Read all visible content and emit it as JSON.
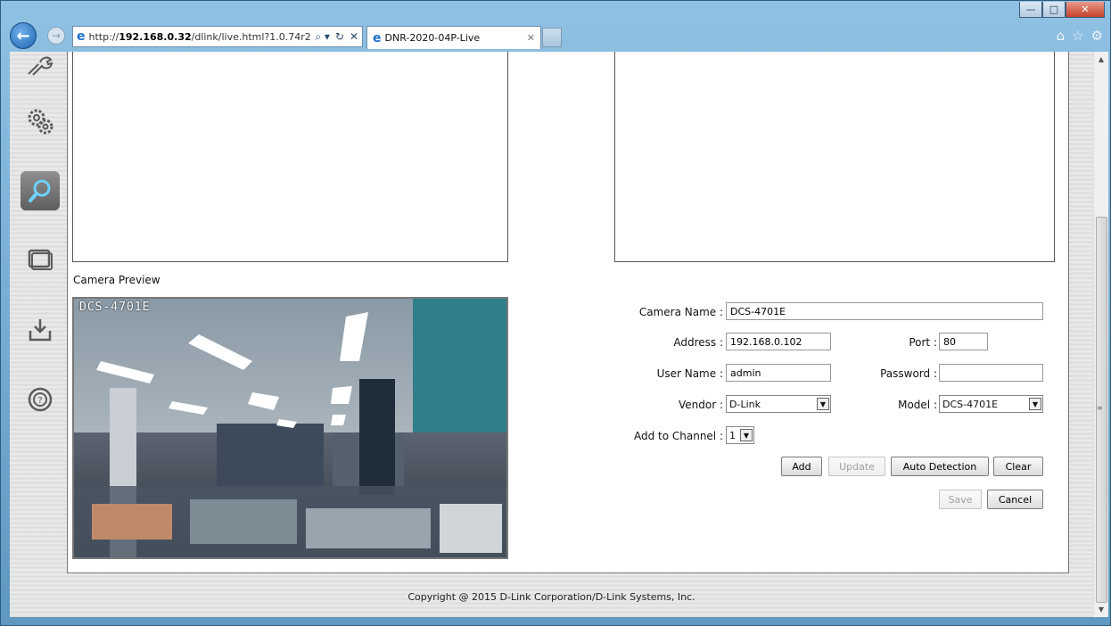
{
  "browser": {
    "window_controls": [
      "—",
      "□",
      "✕"
    ],
    "url_prefix": "http://",
    "url_host": "192.168.0.32",
    "url_path": "/dlink/live.html?1.0.74r2",
    "address_actions": [
      "⌕ ▾",
      "↻",
      "✕"
    ],
    "tab_title": "DNR-2020-04P-Live",
    "tab_close": "✕",
    "tools": [
      "⌂",
      "☆",
      "⚙"
    ]
  },
  "sidebar": {
    "items": [
      {
        "icon": "tools-icon"
      },
      {
        "icon": "settings-gears-icon"
      },
      {
        "icon": "search-icon",
        "active": true
      },
      {
        "icon": "playback-icon"
      },
      {
        "icon": "download-icon"
      },
      {
        "icon": "help-icon"
      }
    ]
  },
  "preview": {
    "label": "Camera Preview",
    "overlay_text": "DCS-4701E"
  },
  "form": {
    "camera_name_label": "Camera Name :",
    "camera_name_value": "DCS-4701E",
    "address_label": "Address :",
    "address_value": "192.168.0.102",
    "port_label": "Port :",
    "port_value": "80",
    "user_name_label": "User Name :",
    "user_name_value": "admin",
    "password_label": "Password :",
    "password_value": "",
    "vendor_label": "Vendor :",
    "vendor_value": "D-Link",
    "model_label": "Model :",
    "model_value": "DCS-4701E",
    "channel_label": "Add to Channel :",
    "channel_value": "1"
  },
  "buttons": {
    "add": "Add",
    "update": "Update",
    "auto_detection": "Auto Detection",
    "clear": "Clear",
    "save": "Save",
    "cancel": "Cancel"
  },
  "footer": {
    "copyright": "Copyright @ 2015 D-Link Corporation/D-Link Systems, Inc."
  }
}
